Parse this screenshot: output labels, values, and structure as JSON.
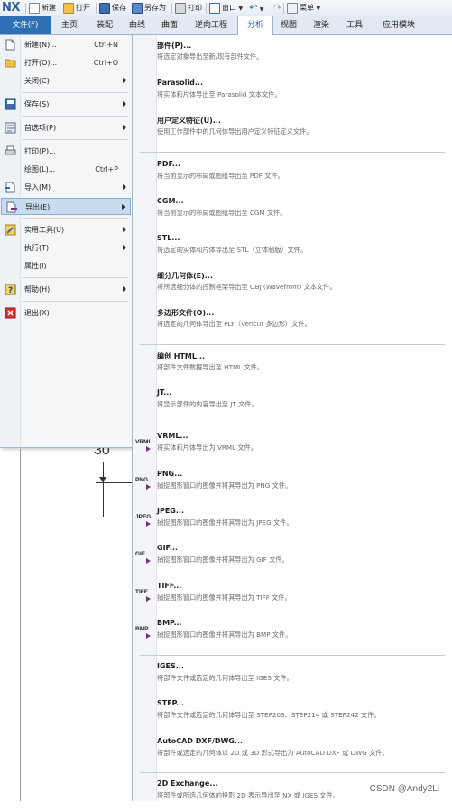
{
  "app": {
    "logo": "NX"
  },
  "quick_access": [
    {
      "label": "新建",
      "icon": "new-file-icon"
    },
    {
      "label": "打开",
      "icon": "open-folder-icon"
    },
    {
      "label": "保存",
      "icon": "save-disk-icon"
    },
    {
      "label": "另存为",
      "icon": "save-as-icon"
    },
    {
      "label": "打印",
      "icon": "printer-icon"
    },
    {
      "label": "窗口",
      "icon": "window-icon"
    },
    {
      "label": "菜单",
      "icon": "menu-icon"
    }
  ],
  "ribbon": {
    "file_tab": "文件(F)",
    "tabs": [
      "主页",
      "装配",
      "曲线",
      "曲面",
      "逆向工程",
      "分析",
      "视图",
      "渲染",
      "工具",
      "应用模块"
    ],
    "active_tab": "分析"
  },
  "file_menu": [
    {
      "label": "新建(N)...",
      "key": "Ctrl+N",
      "icon": "new-file-icon",
      "arrow": false
    },
    {
      "label": "打开(O)...",
      "key": "Ctrl+O",
      "icon": "open-folder-icon",
      "arrow": false
    },
    {
      "label": "关闭(C)",
      "key": "",
      "icon": "",
      "arrow": true
    },
    {
      "label": "保存(S)",
      "key": "",
      "icon": "save-disk-icon",
      "arrow": true
    },
    {
      "label": "首选项(P)",
      "key": "",
      "icon": "preferences-icon",
      "arrow": true
    },
    {
      "label": "打印(P)...",
      "key": "",
      "icon": "printer-icon",
      "arrow": false
    },
    {
      "label": "绘图(L)...",
      "key": "Ctrl+P",
      "icon": "",
      "arrow": false
    },
    {
      "label": "导入(M)",
      "key": "",
      "icon": "import-icon",
      "arrow": true
    },
    {
      "label": "导出(E)",
      "key": "",
      "icon": "export-icon",
      "arrow": true
    },
    {
      "label": "实用工具(U)",
      "key": "",
      "icon": "utilities-icon",
      "arrow": true
    },
    {
      "label": "执行(T)",
      "key": "",
      "icon": "",
      "arrow": true
    },
    {
      "label": "属性(I)",
      "key": "",
      "icon": "",
      "arrow": false
    },
    {
      "label": "帮助(H)",
      "key": "",
      "icon": "help-icon",
      "arrow": true
    },
    {
      "label": "退出(X)",
      "key": "",
      "icon": "exit-icon",
      "arrow": false
    }
  ],
  "export_menu": [
    {
      "title": "部件(P)...",
      "desc": "将选定对象导出至新/现有部件文件。",
      "icon": ""
    },
    {
      "title": "Parasolid...",
      "desc": "将实体和片体导出至 Parasolid 文本文件。",
      "icon": ""
    },
    {
      "title": "用户定义特征(U)...",
      "desc": "使用工作部件中的几何体导出用户定义特征定义文件。",
      "icon": ""
    },
    {
      "title": "PDF...",
      "desc": "将当前显示的布局或图纸导出至 PDF 文件。",
      "icon": ""
    },
    {
      "title": "CGM...",
      "desc": "将当前显示的布局或图纸导出至 CGM 文件。",
      "icon": ""
    },
    {
      "title": "STL...",
      "desc": "将选定的实体和片体导出至 STL（立体制版）文件。",
      "icon": ""
    },
    {
      "title": "细分几何体(E)...",
      "desc": "将所选细分体的控制框架导出至 OBJ (Wavefront) 文本文件。",
      "icon": ""
    },
    {
      "title": "多边形文件(O)...",
      "desc": "将选定的几何体导出至 PLY（Vericut 多边形）文件。",
      "icon": ""
    },
    {
      "title": "编创 HTML...",
      "desc": "将部件文件数据导出至 HTML 文件。",
      "icon": ""
    },
    {
      "title": "JT...",
      "desc": "将显示部件的内容导出至 JT 文件。",
      "icon": ""
    },
    {
      "title": "VRML...",
      "desc": "将实体和片体导出为 VRML 文件。",
      "icon": "VRML"
    },
    {
      "title": "PNG...",
      "desc": "捕捉图形窗口的图像并将其导出为 PNG 文件。",
      "icon": "PNG"
    },
    {
      "title": "JPEG...",
      "desc": "捕捉图形窗口的图像并将其导出为 JPEG 文件。",
      "icon": "JPEG"
    },
    {
      "title": "GIF...",
      "desc": "捕捉图形窗口的图像并将其导出为 GIF 文件。",
      "icon": "GIF"
    },
    {
      "title": "TIFF...",
      "desc": "捕捉图形窗口的图像并将其导出为 TIFF 文件。",
      "icon": "TIFF"
    },
    {
      "title": "BMP...",
      "desc": "捕捉图形窗口的图像并将其导出为 BMP 文件。",
      "icon": "BMP"
    },
    {
      "title": "IGES...",
      "desc": "将部件文件或选定的几何体导出至 IGES 文件。",
      "icon": ""
    },
    {
      "title": "STEP...",
      "desc": "将部件文件或选定的几何体导出至 STEP203、STEP214 或 STEP242 文件。",
      "icon": ""
    },
    {
      "title": "AutoCAD DXF/DWG...",
      "desc": "将部件或选定的几何体以 2D 或 3D 形式导出为 AutoCAD DXF 或 DWG 文件。",
      "icon": ""
    },
    {
      "title": "2D Exchange...",
      "desc": "将部件或所选几何体的投影 2D 表示导出至 NX 或 IGES 文件。",
      "icon": ""
    }
  ],
  "canvas": {
    "dimension_value": "30"
  },
  "watermark": "CSDN @Andy2Li",
  "colors": {
    "accent": "#2f6fb3",
    "highlight": "#c8dcef",
    "image_arrow": "#7a2d8f"
  }
}
